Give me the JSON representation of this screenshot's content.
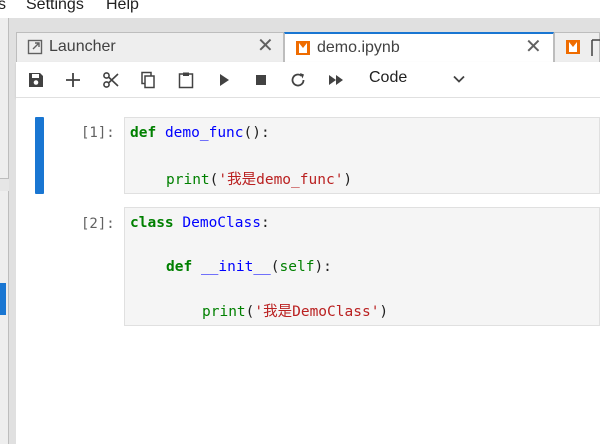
{
  "menu": {
    "items": [
      "s",
      "Settings",
      "Help"
    ]
  },
  "tabs": [
    {
      "label": "Launcher",
      "close": "✕"
    },
    {
      "label": "demo.ipynb",
      "close": "✕"
    },
    {
      "label": ""
    }
  ],
  "toolbar": {
    "buttons": [
      "save",
      "insert-cell",
      "cut",
      "copy",
      "paste",
      "run",
      "interrupt",
      "restart",
      "run-all"
    ],
    "cell_type": "Code"
  },
  "cells": [
    {
      "prompt": "[1]:",
      "lines": [
        {
          "kw": "def",
          "name": "demo_func",
          "rest": "():"
        },
        {
          "builtin": "print",
          "open": "(",
          "string": "'我是demo_func'",
          "close": ")"
        }
      ]
    },
    {
      "prompt": "[2]:",
      "lines": [
        {
          "kw": "class",
          "name": "DemoClass",
          "rest": ":"
        },
        {
          "kw": "def",
          "name": "__init__",
          "open": "(",
          "param": "self",
          "close": "):"
        },
        {
          "builtin": "print",
          "open": "(",
          "string": "'我是DemoClass'",
          "close": ")"
        }
      ]
    }
  ],
  "colors": {
    "accent": "#1976d2",
    "keyword": "#008000",
    "definition": "#0000ff",
    "string": "#ba2121"
  }
}
